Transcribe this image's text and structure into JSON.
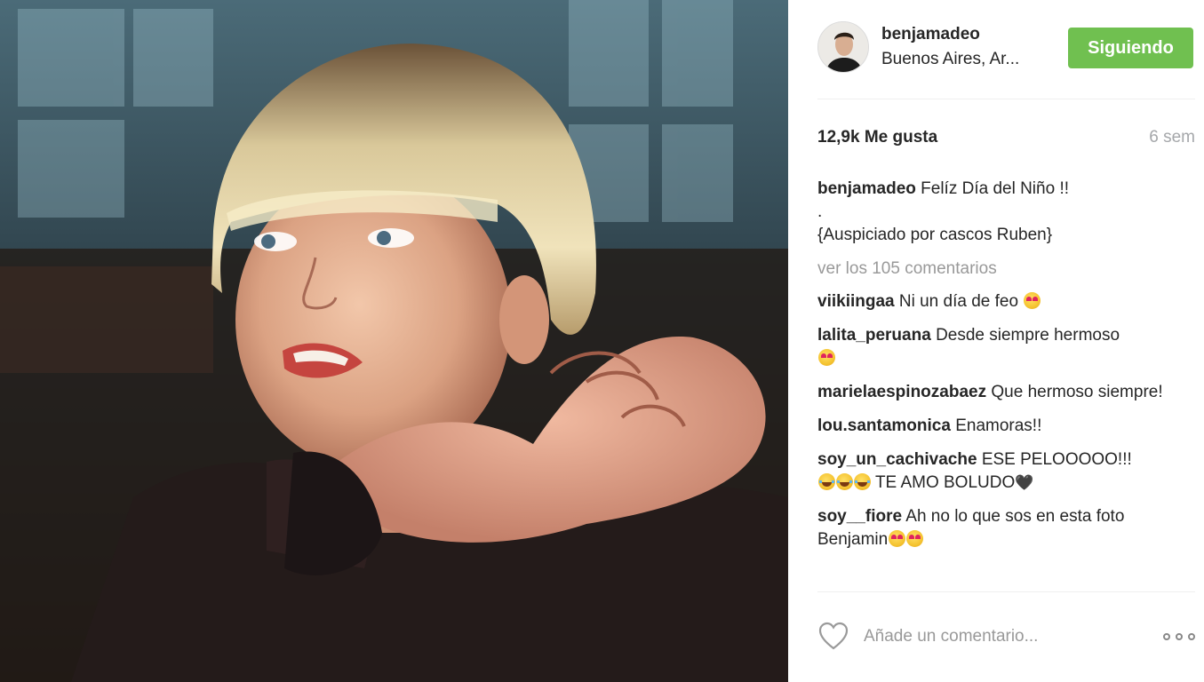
{
  "post": {
    "header": {
      "username": "benjamadeo",
      "location": "Buenos Aires, Ar...",
      "follow_label": "Siguiendo",
      "follow_color": "#70c050"
    },
    "likes": "12,9k Me gusta",
    "time_ago": "6 sem",
    "caption": {
      "user": "benjamadeo",
      "line1": "Felíz Día del Niño !!",
      "line2": ".",
      "line3": "{Auspiciado por cascos Ruben}"
    },
    "view_all_comments": "ver los 105 comentarios",
    "comments": [
      {
        "user": "viikiingaa",
        "text": "Ni un día de feo",
        "emoji": [
          "heart-eyes"
        ]
      },
      {
        "user": "lalita_peruana",
        "text": "Desde siempre hermoso",
        "emoji": [
          "heart-eyes"
        ]
      },
      {
        "user": "marielaespinozabaez",
        "text": "Que hermoso siempre!",
        "emoji": []
      },
      {
        "user": "lou.santamonica",
        "text": "Enamoras!!",
        "emoji": []
      },
      {
        "user": "soy_un_cachivache",
        "text": "ESE PELOOOOO!!!",
        "text2": "TE AMO BOLUDO",
        "emoji": [
          "joy",
          "joy",
          "joy"
        ],
        "trailing": "🖤"
      },
      {
        "user": "soy__fiore",
        "text": "Ah no lo que sos en esta foto Benjamin",
        "emoji": [
          "heart-eyes",
          "heart-eyes"
        ]
      }
    ],
    "footer": {
      "like_icon": "heart-outline-icon",
      "comment_placeholder": "Añade un comentario...",
      "more_icon": "more-options-icon"
    }
  }
}
